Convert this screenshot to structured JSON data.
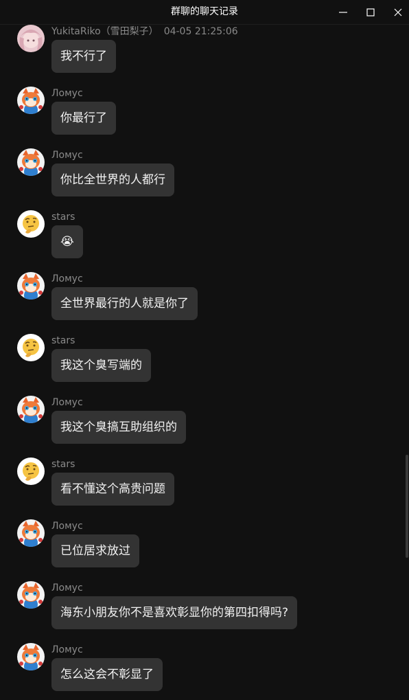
{
  "window": {
    "title": "群聊的聊天记录",
    "controls": [
      "minimize-icon",
      "maximize-icon",
      "close-icon"
    ]
  },
  "messages": [
    {
      "sender": "YukitaRiko（雪田梨子）",
      "time": "04-05 21:25:06",
      "text": "我不行了",
      "avatar": "pink-hair-avatar"
    },
    {
      "sender": "Ломус",
      "time": "",
      "text": "你最行了",
      "avatar": "fox-avatar"
    },
    {
      "sender": "Ломус",
      "time": "",
      "text": "你比全世界的人都行",
      "avatar": "fox-avatar"
    },
    {
      "sender": "stars",
      "time": "",
      "text": "😭",
      "avatar": "thinking-face-avatar"
    },
    {
      "sender": "Ломус",
      "time": "",
      "text": "全世界最行的人就是你了",
      "avatar": "fox-avatar"
    },
    {
      "sender": "stars",
      "time": "",
      "text": "我这个臭写端的",
      "avatar": "thinking-face-avatar"
    },
    {
      "sender": "Ломус",
      "time": "",
      "text": "我这个臭搞互助组织的",
      "avatar": "fox-avatar"
    },
    {
      "sender": "stars",
      "time": "",
      "text": "看不懂这个高贵问题",
      "avatar": "thinking-face-avatar"
    },
    {
      "sender": "Ломус",
      "time": "",
      "text": "已位居求放过",
      "avatar": "fox-avatar"
    },
    {
      "sender": "Ломус",
      "time": "",
      "text": "海东小朋友你不是喜欢彰显你的第四扣得吗?",
      "avatar": "fox-avatar"
    },
    {
      "sender": "Ломус",
      "time": "",
      "text": "怎么这会不彰显了",
      "avatar": "fox-avatar"
    }
  ],
  "colors": {
    "background": "#111111",
    "bubble": "#333333",
    "name": "#8a8a8a",
    "text": "#f2f2f2"
  }
}
